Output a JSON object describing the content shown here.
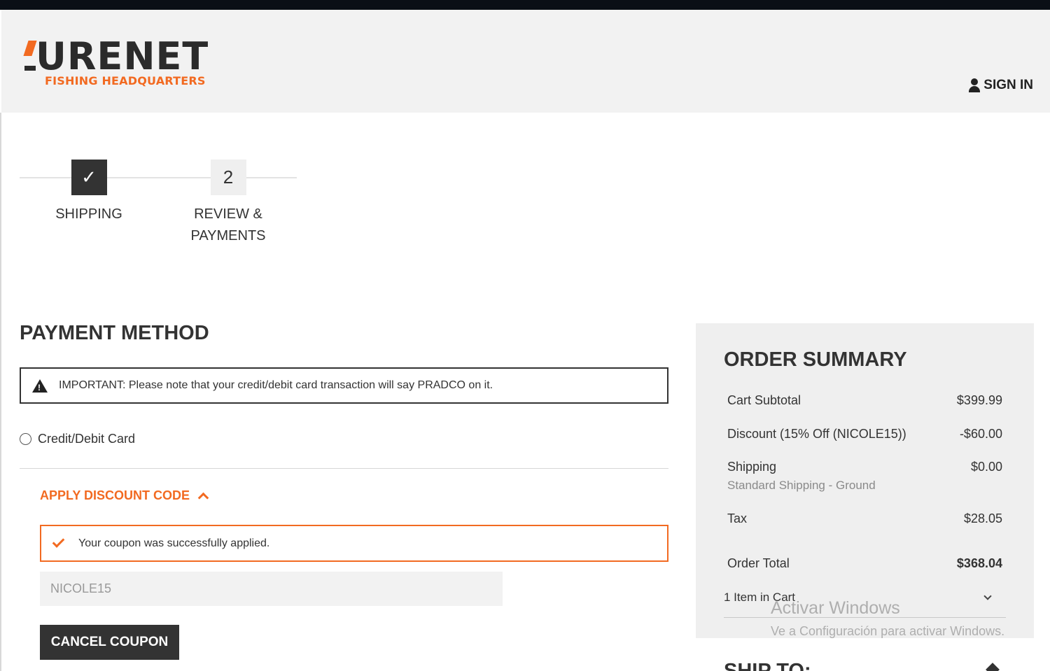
{
  "header": {
    "logo_main": "URENET",
    "logo_sub": "FISHING HEADQUARTERS",
    "signin_label": "SIGN IN"
  },
  "steps": [
    {
      "marker": "✓",
      "label": "SHIPPING",
      "state": "done"
    },
    {
      "marker": "2",
      "label": "REVIEW & PAYMENTS",
      "state": "current"
    }
  ],
  "payment": {
    "title": "PAYMENT METHOD",
    "notice": "IMPORTANT: Please note that your credit/debit card transaction will say PRADCO on it.",
    "option_label": "Credit/Debit Card"
  },
  "discount": {
    "toggle_label": "APPLY DISCOUNT CODE",
    "success_message": "Your coupon was successfully applied.",
    "code_value": "NICOLE15",
    "cancel_label": "CANCEL COUPON"
  },
  "summary": {
    "title": "ORDER SUMMARY",
    "cart_subtotal_label": "Cart Subtotal",
    "cart_subtotal_value": "$399.99",
    "discount_label": "Discount (15% Off (NICOLE15))",
    "discount_value": "-$60.00",
    "shipping_label": "Shipping",
    "shipping_value": "$0.00",
    "shipping_method": "Standard Shipping - Ground",
    "tax_label": "Tax",
    "tax_value": "$28.05",
    "total_label": "Order Total",
    "total_value": "$368.04",
    "items_label": "1 Item in Cart"
  },
  "ship_to": {
    "title": "SHIP TO:"
  },
  "watermark": {
    "title": "Activar Windows",
    "subtitle": "Ve a Configuración para activar Windows."
  },
  "colors": {
    "accent": "#f26a21",
    "dark": "#333333",
    "panel": "#efefef"
  }
}
